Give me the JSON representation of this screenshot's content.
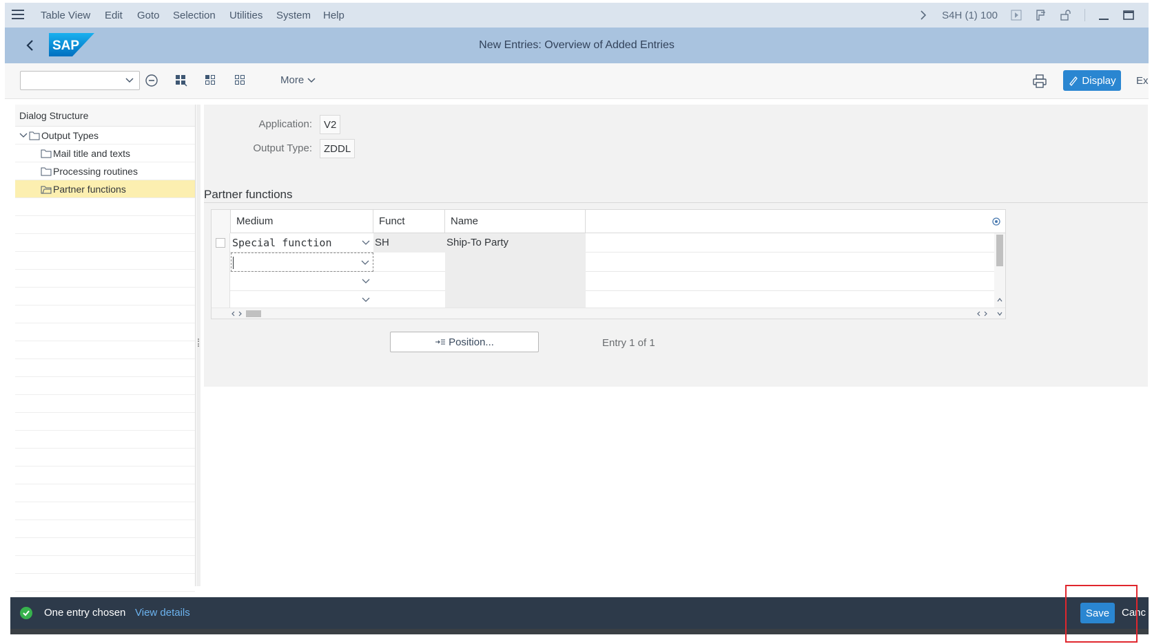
{
  "menubar": {
    "items": [
      "Table View",
      "Edit",
      "Goto",
      "Selection",
      "Utilities",
      "System",
      "Help"
    ],
    "system_id": "S4H (1) 100"
  },
  "titlebar": {
    "logo_text": "SAP",
    "title": "New Entries: Overview of Added Entries"
  },
  "toolbar": {
    "select_value": "",
    "more_label": "More",
    "display_label": "Display",
    "exit_label": "Ex"
  },
  "dialog_structure": {
    "header": "Dialog Structure",
    "items": [
      {
        "label": "Output Types",
        "level": 0,
        "expanded": true
      },
      {
        "label": "Mail title and texts",
        "level": 1
      },
      {
        "label": "Processing routines",
        "level": 1
      },
      {
        "label": "Partner functions",
        "level": 1,
        "selected": true
      }
    ]
  },
  "header_fields": {
    "application_label": "Application:",
    "application_value": "V2",
    "output_type_label": "Output Type:",
    "output_type_value": "ZDDL"
  },
  "partner_functions": {
    "section_title": "Partner functions",
    "columns": [
      "Medium",
      "Funct",
      "Name"
    ],
    "rows": [
      {
        "medium": "Special function",
        "funct": "SH",
        "name": "Ship-To Party"
      },
      {
        "medium": "",
        "funct": "",
        "name": ""
      },
      {
        "medium": "",
        "funct": "",
        "name": ""
      },
      {
        "medium": "",
        "funct": "",
        "name": ""
      }
    ],
    "position_button": "Position...",
    "entry_info": "Entry 1 of 1"
  },
  "statusbar": {
    "message": "One entry chosen",
    "link": "View details",
    "save_label": "Save",
    "cancel_label": "Canc"
  },
  "colors": {
    "menubar_bg": "#dbe4ee",
    "titlebar_bg": "#a9c3df",
    "accent_button": "#2a86d1",
    "selected_row": "#fcefb0",
    "statusbar_bg": "#2d3a4a",
    "success": "#37b24d",
    "highlight_box": "#e0262d"
  }
}
